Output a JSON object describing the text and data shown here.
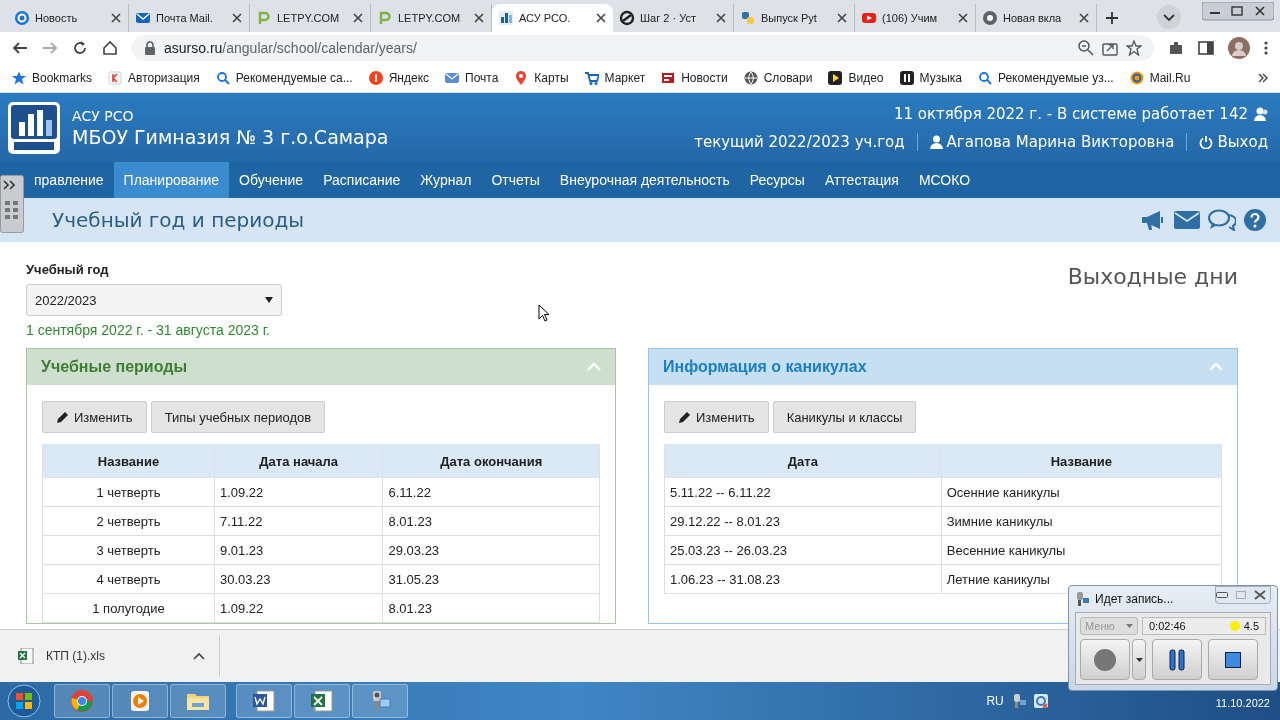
{
  "browser": {
    "tabs": [
      {
        "label": "Новость",
        "selected": false
      },
      {
        "label": "Почта Mail.",
        "selected": false
      },
      {
        "label": "LETPY.COM",
        "selected": false
      },
      {
        "label": "LETPY.COM",
        "selected": false
      },
      {
        "label": "АСУ РСО.",
        "selected": true
      },
      {
        "label": "Шаг 2 · Уст",
        "selected": false
      },
      {
        "label": "Выпуск Pyt",
        "selected": false
      },
      {
        "label": "(106) Учим",
        "selected": false
      },
      {
        "label": "Новая вкла",
        "selected": false
      }
    ],
    "address": {
      "host": "asurso.ru",
      "path": "/angular/school/calendar/years/"
    },
    "bookmarks": [
      "Bookmarks",
      "Авторизация",
      "Рекомендуемые са...",
      "Яндекс",
      "Почта",
      "Карты",
      "Маркет",
      "Новости",
      "Словари",
      "Видео",
      "Музыка",
      "Рекомендуемые уз...",
      "Mail.Ru"
    ]
  },
  "header": {
    "system": "АСУ РСО",
    "school": "МБОУ Гимназия № 3 г.о.Самара",
    "date_line": "11 октября 2022 г. - В системе работает 142",
    "year_line": "текущий 2022/2023 уч.год",
    "user": "Агапова Марина Викторовна",
    "logout": "Выход"
  },
  "nav": [
    {
      "label": "правление",
      "selected": false
    },
    {
      "label": "Планирование",
      "selected": true
    },
    {
      "label": "Обучение",
      "selected": false
    },
    {
      "label": "Расписание",
      "selected": false
    },
    {
      "label": "Журнал",
      "selected": false
    },
    {
      "label": "Отчеты",
      "selected": false
    },
    {
      "label": "Внеурочная деятельность",
      "selected": false
    },
    {
      "label": "Ресурсы",
      "selected": false
    },
    {
      "label": "Аттестация",
      "selected": false
    },
    {
      "label": "МСОКО",
      "selected": false
    }
  ],
  "page": {
    "title": "Учебный год и периоды",
    "year_field": {
      "label": "Учебный год",
      "value": "2022/2023"
    },
    "year_range": "1 сентября 2022 г. - 31 августа 2023 г.",
    "weekends_link": "Выходные дни",
    "panels": [
      {
        "title": "Учебные периоды",
        "color": "#3e7d35",
        "expanded": true,
        "buttons": [
          "Изменить",
          "Типы учебных периодов"
        ],
        "columns": [
          "Название",
          "Дата начала",
          "Дата окончания"
        ],
        "rows": [
          [
            "1 четверть",
            "1.09.22",
            "6.11.22"
          ],
          [
            "2 четверть",
            "7.11.22",
            "8.01.23"
          ],
          [
            "3 четверть",
            "9.01.23",
            "29.03.23"
          ],
          [
            "4 четверть",
            "30.03.23",
            "31.05.23"
          ],
          [
            "1 полугодие",
            "1.09.22",
            "8.01.23"
          ]
        ]
      },
      {
        "title": "Информация о каникулах",
        "color": "#1a7fcb",
        "expanded": true,
        "buttons": [
          "Изменить",
          "Каникулы и классы"
        ],
        "columns": [
          "Дата",
          "Название"
        ],
        "rows": [
          [
            "5.11.22 -- 6.11.22",
            "Осенние каникулы"
          ],
          [
            "29.12.22 -- 8.01.23",
            "Зимние каникулы"
          ],
          [
            "25.03.23 -- 26.03.23",
            "Весенние каникулы"
          ],
          [
            "1.06.23 -- 31.08.23",
            "Летние каникулы"
          ]
        ]
      }
    ]
  },
  "downloads": [
    {
      "file": "КТП (1).xls"
    }
  ],
  "taskbar": {
    "language": "RU",
    "clock": "11.10.2022"
  },
  "recorder": {
    "title": "Идет запись...",
    "menu": "Меню",
    "time": "0:02:46",
    "value": "4.5"
  }
}
